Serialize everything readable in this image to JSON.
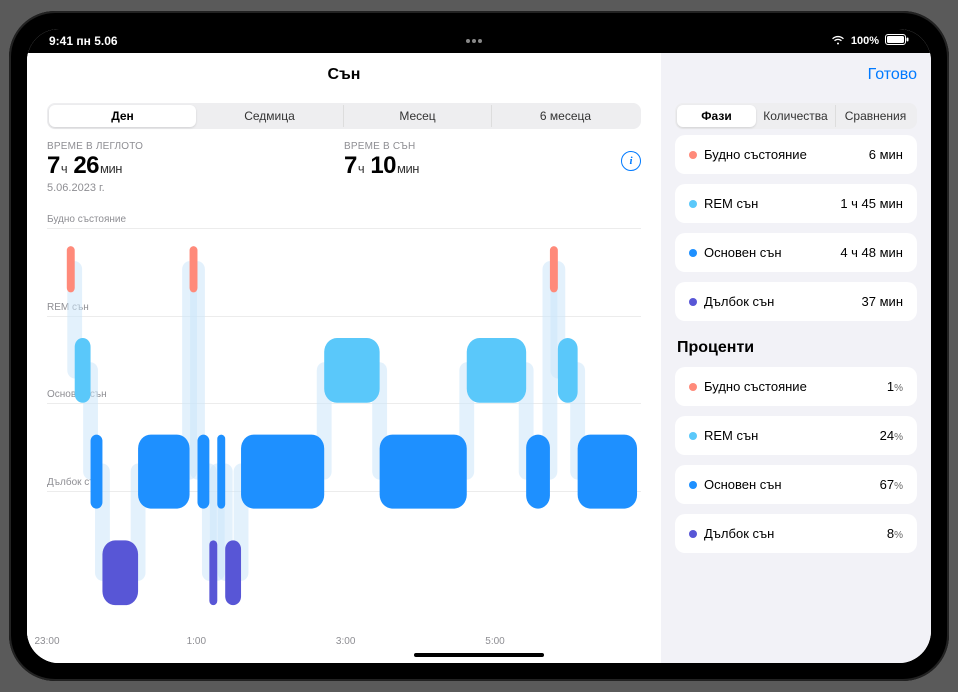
{
  "statusbar": {
    "time": "9:41",
    "date": "пн 5.06",
    "battery": "100%"
  },
  "title": "Сън",
  "done": "Готово",
  "range_segments": [
    "Ден",
    "Седмица",
    "Месец",
    "6 месеца"
  ],
  "range_active_index": 0,
  "stats": {
    "bed": {
      "label": "ВРЕМЕ В ЛЕГЛОТО",
      "h": "7",
      "h_unit": "ч",
      "m": "26",
      "m_unit": "мин",
      "date": "5.06.2023 г."
    },
    "sleep": {
      "label": "ВРЕМЕ В СЪН",
      "h": "7",
      "h_unit": "ч",
      "m": "10",
      "m_unit": "мин"
    }
  },
  "stage_labels": {
    "awake": "Будно състояние",
    "rem": "REM сън",
    "core": "Основен сън",
    "deep": "Дълбок сън"
  },
  "colors": {
    "awake": "#ff8a7a",
    "rem": "#5ac8fa",
    "core": "#1e90ff",
    "deep": "#5856d6"
  },
  "side_segments": [
    "Фази",
    "Количества",
    "Сравнения"
  ],
  "side_active_index": 0,
  "phase_values": {
    "awake": "6 мин",
    "rem": "1 ч 45 мин",
    "core": "4 ч 48 мин",
    "deep": "37 мин"
  },
  "percent_title": "Проценти",
  "percent_values": {
    "awake": "1",
    "rem": "24",
    "core": "67",
    "deep": "8"
  },
  "percent_unit": "%",
  "chart_data": {
    "type": "hypnogram",
    "stages": [
      "Будно състояние",
      "REM сън",
      "Основен сън",
      "Дълбок сън"
    ],
    "x_ticks": [
      "23:00",
      "1:00",
      "3:00",
      "5:00"
    ],
    "x_range_hours": [
      23,
      6.5
    ],
    "segments": [
      {
        "stage": "awake",
        "start": 23.25,
        "end": 23.35
      },
      {
        "stage": "rem",
        "start": 23.35,
        "end": 23.55
      },
      {
        "stage": "core",
        "start": 23.55,
        "end": 23.7
      },
      {
        "stage": "deep",
        "start": 23.7,
        "end": 24.15
      },
      {
        "stage": "core",
        "start": 24.15,
        "end": 24.8
      },
      {
        "stage": "awake",
        "start": 24.8,
        "end": 24.9
      },
      {
        "stage": "core",
        "start": 24.9,
        "end": 25.05
      },
      {
        "stage": "deep",
        "start": 25.05,
        "end": 25.15
      },
      {
        "stage": "core",
        "start": 25.15,
        "end": 25.25
      },
      {
        "stage": "deep",
        "start": 25.25,
        "end": 25.45
      },
      {
        "stage": "core",
        "start": 25.45,
        "end": 26.5
      },
      {
        "stage": "rem",
        "start": 26.5,
        "end": 27.2
      },
      {
        "stage": "core",
        "start": 27.2,
        "end": 28.3
      },
      {
        "stage": "rem",
        "start": 28.3,
        "end": 29.05
      },
      {
        "stage": "core",
        "start": 29.05,
        "end": 29.35
      },
      {
        "stage": "awake",
        "start": 29.35,
        "end": 29.45
      },
      {
        "stage": "rem",
        "start": 29.45,
        "end": 29.7
      },
      {
        "stage": "core",
        "start": 29.7,
        "end": 30.45
      }
    ]
  }
}
